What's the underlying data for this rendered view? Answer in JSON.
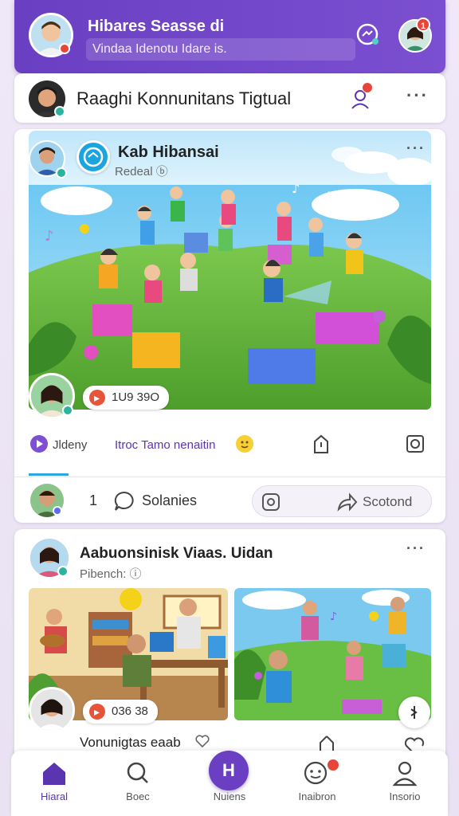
{
  "header": {
    "title": "Hibares Seasse di",
    "subtitle": "Vindaa Idenotu Idare is.",
    "notification_badge": "1"
  },
  "composer": {
    "text": "Raaghi Konnunitans Tigtual"
  },
  "post1": {
    "author": "Kab Hibansai",
    "meta": "Redeal ⓑ",
    "audio_chip": "1U9 39O",
    "react_left": "Jldeny",
    "react_mid": "Itroc Tamo nenaitin",
    "comment_count": "1",
    "comment_label": "Solanies",
    "share_label": "Scotond"
  },
  "post2": {
    "author": "Aabuonsinisk Viaas. Uidan",
    "meta": "Pibench: ⓘ",
    "audio_chip": "036 38",
    "caption": "Vonunigtas eaab"
  },
  "nav": {
    "items": [
      {
        "label": "Hiaral",
        "icon": "home-icon"
      },
      {
        "label": "Boec",
        "icon": "search-icon"
      },
      {
        "label": "Nuiens",
        "icon": "create-icon"
      },
      {
        "label": "Inaibron",
        "icon": "notifications-icon"
      },
      {
        "label": "Insorio",
        "icon": "profile-icon"
      }
    ],
    "fab_label": "H"
  },
  "colors": {
    "brand": "#6a3fc2",
    "badge": "#e8443a",
    "status_online": "#2bb3a0"
  }
}
